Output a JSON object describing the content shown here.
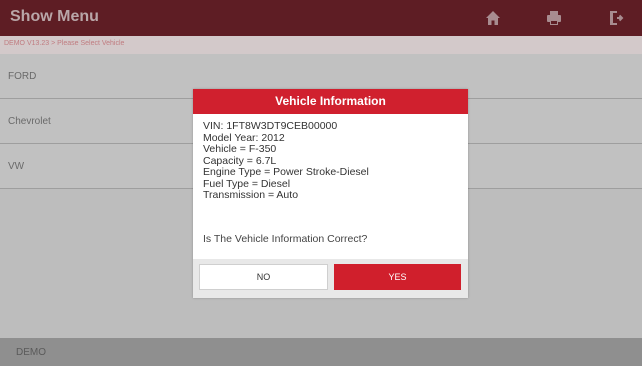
{
  "header": {
    "title": "Show Menu",
    "home_icon": "home-icon",
    "print_icon": "print-icon",
    "exit_icon": "exit-icon"
  },
  "breadcrumb": "DEMO V13.23 > Please Select Vehicle",
  "list": {
    "items": [
      {
        "label": "FORD"
      },
      {
        "label": "Chevrolet"
      },
      {
        "label": "VW"
      }
    ]
  },
  "footer": {
    "label": "DEMO"
  },
  "dialog": {
    "title": "Vehicle Information",
    "lines": [
      "VIN: 1FT8W3DT9CEB00000",
      "Model Year: 2012",
      "Vehicle = F-350",
      "Capacity = 6.7L",
      "Engine Type = Power Stroke-Diesel",
      "Fuel Type = Diesel",
      "Transmission = Auto"
    ],
    "question": "Is The Vehicle Information Correct?",
    "no_label": "NO",
    "yes_label": "YES"
  },
  "colors": {
    "header_bg": "#5e1d24",
    "dialog_title_bg": "#d0202e",
    "yes_button_bg": "#d01f2c"
  }
}
